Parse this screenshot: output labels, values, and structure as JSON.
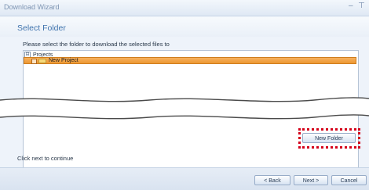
{
  "window": {
    "title": "Download Wizard",
    "minimize_glyph": "–",
    "restore_glyph": "⊤"
  },
  "page": {
    "section_title": "Select Folder",
    "instruction": "Please select the folder to download the selected files to",
    "footer_hint": "Click next to continue"
  },
  "tree": {
    "root": {
      "label": "Projects",
      "expander": "⊟"
    },
    "selected_child": {
      "label": "New Project",
      "icon": "folder-icon"
    }
  },
  "buttons": {
    "new_folder": "New Folder",
    "back": "< Back",
    "next": "Next >",
    "cancel": "Cancel"
  },
  "colors": {
    "accent_title": "#3f73ad",
    "selection": "#ec9832",
    "highlight_dots": "#d4001a"
  }
}
